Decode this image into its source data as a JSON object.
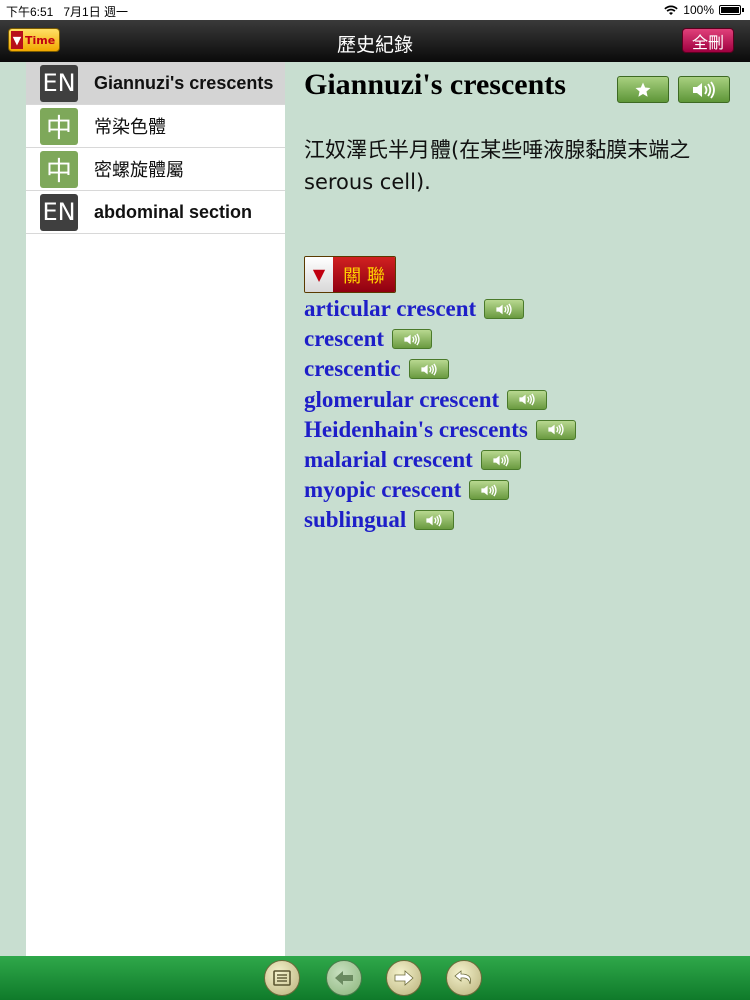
{
  "status_bar": {
    "time": "下午6:51",
    "date": "7月1日 週一",
    "battery": "100%"
  },
  "nav": {
    "title": "歷史紀錄",
    "time_button": "Time",
    "delete_all_button": "全刪"
  },
  "history": [
    {
      "lang": "EN",
      "label": "Giannuzi's crescents",
      "selected": true
    },
    {
      "lang": "中",
      "label": "常染色體",
      "selected": false
    },
    {
      "lang": "中",
      "label": "密螺旋體屬",
      "selected": false
    },
    {
      "lang": "EN",
      "label": "abdominal section",
      "selected": false
    }
  ],
  "entry": {
    "headword": "Giannuzi's crescents",
    "definition": "江奴澤氏半月體(在某些唾液腺黏膜末端之serous cell)."
  },
  "related": {
    "label": "關 聯",
    "items": [
      "articular crescent",
      "crescent",
      "crescentic",
      "glomerular crescent",
      "Heidenhain's crescents",
      "malarial crescent",
      "myopic crescent",
      "sublingual"
    ]
  },
  "colors": {
    "accent_green": "#2fa84a",
    "link_blue": "#1e1ec8",
    "related_red": "#b01018"
  },
  "icons": {
    "star": "star-icon",
    "speaker": "speaker-icon",
    "bottom": [
      "list-icon",
      "back-arrow-icon",
      "forward-arrow-icon",
      "return-icon"
    ]
  }
}
